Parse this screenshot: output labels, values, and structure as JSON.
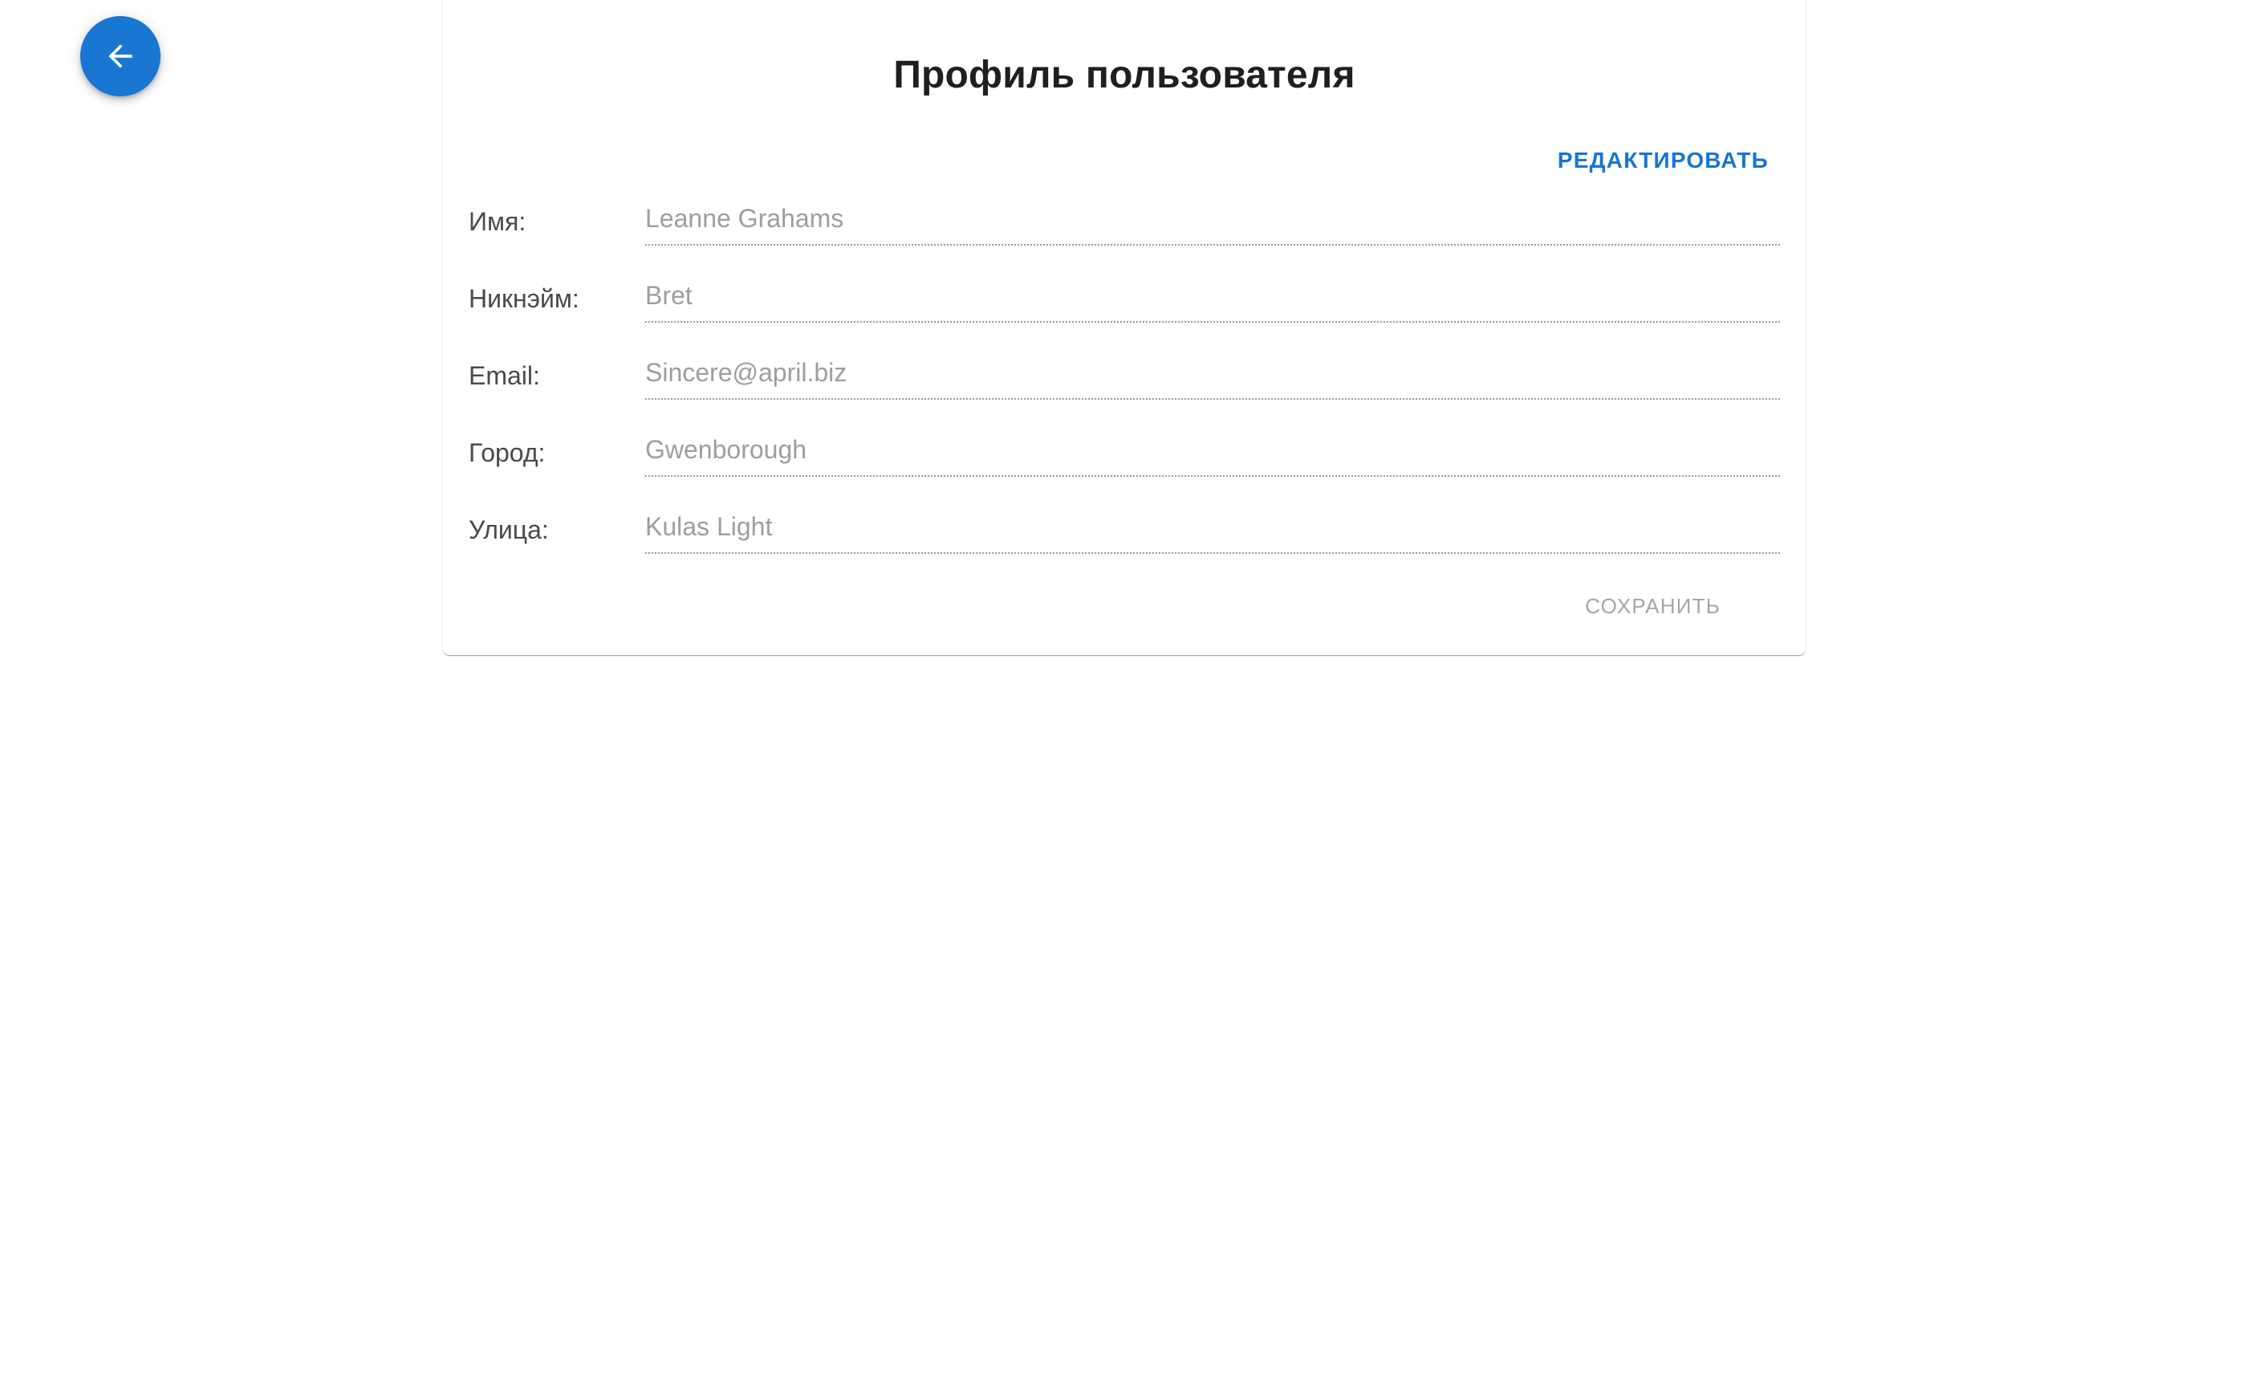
{
  "back_button": {
    "icon": "arrow-left-icon",
    "color": "#1976d2"
  },
  "profile": {
    "title": "Профиль пользователя",
    "edit_label": "РЕДАКТИРОВАТЬ",
    "save_label": "СОХРАНИТЬ",
    "accent_color": "#1976d2",
    "fields": [
      {
        "label": "Имя:",
        "value": "Leanne Grahams"
      },
      {
        "label": "Никнэйм:",
        "value": "Bret"
      },
      {
        "label": "Email:",
        "value": "Sincere@april.biz"
      },
      {
        "label": "Город:",
        "value": "Gwenborough"
      },
      {
        "label": "Улица:",
        "value": "Kulas Light"
      }
    ]
  }
}
